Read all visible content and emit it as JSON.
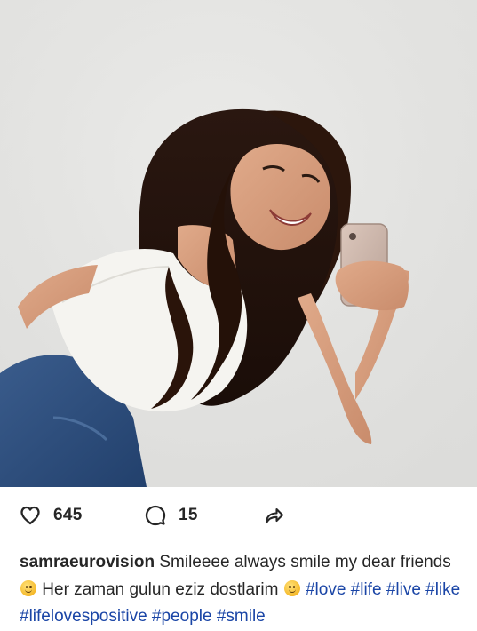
{
  "post": {
    "likes_count": "645",
    "comments_count": "15"
  },
  "caption": {
    "username": "samraeurovision",
    "text_1": "Smileeee always smile my dear friends",
    "text_2": "Her zaman gulun eziz dostlarim",
    "hashtags": [
      "#love",
      "#life",
      "#live",
      "#like",
      "#lifelovespositive",
      "#people",
      "#smile"
    ]
  },
  "icons": {
    "like": "heart-icon",
    "comment": "comment-icon",
    "share": "share-arrow-icon",
    "emoji": "smiling-face-emoji"
  },
  "colors": {
    "hashtag": "#1a45a6",
    "text": "#262626",
    "background": "#ffffff"
  }
}
